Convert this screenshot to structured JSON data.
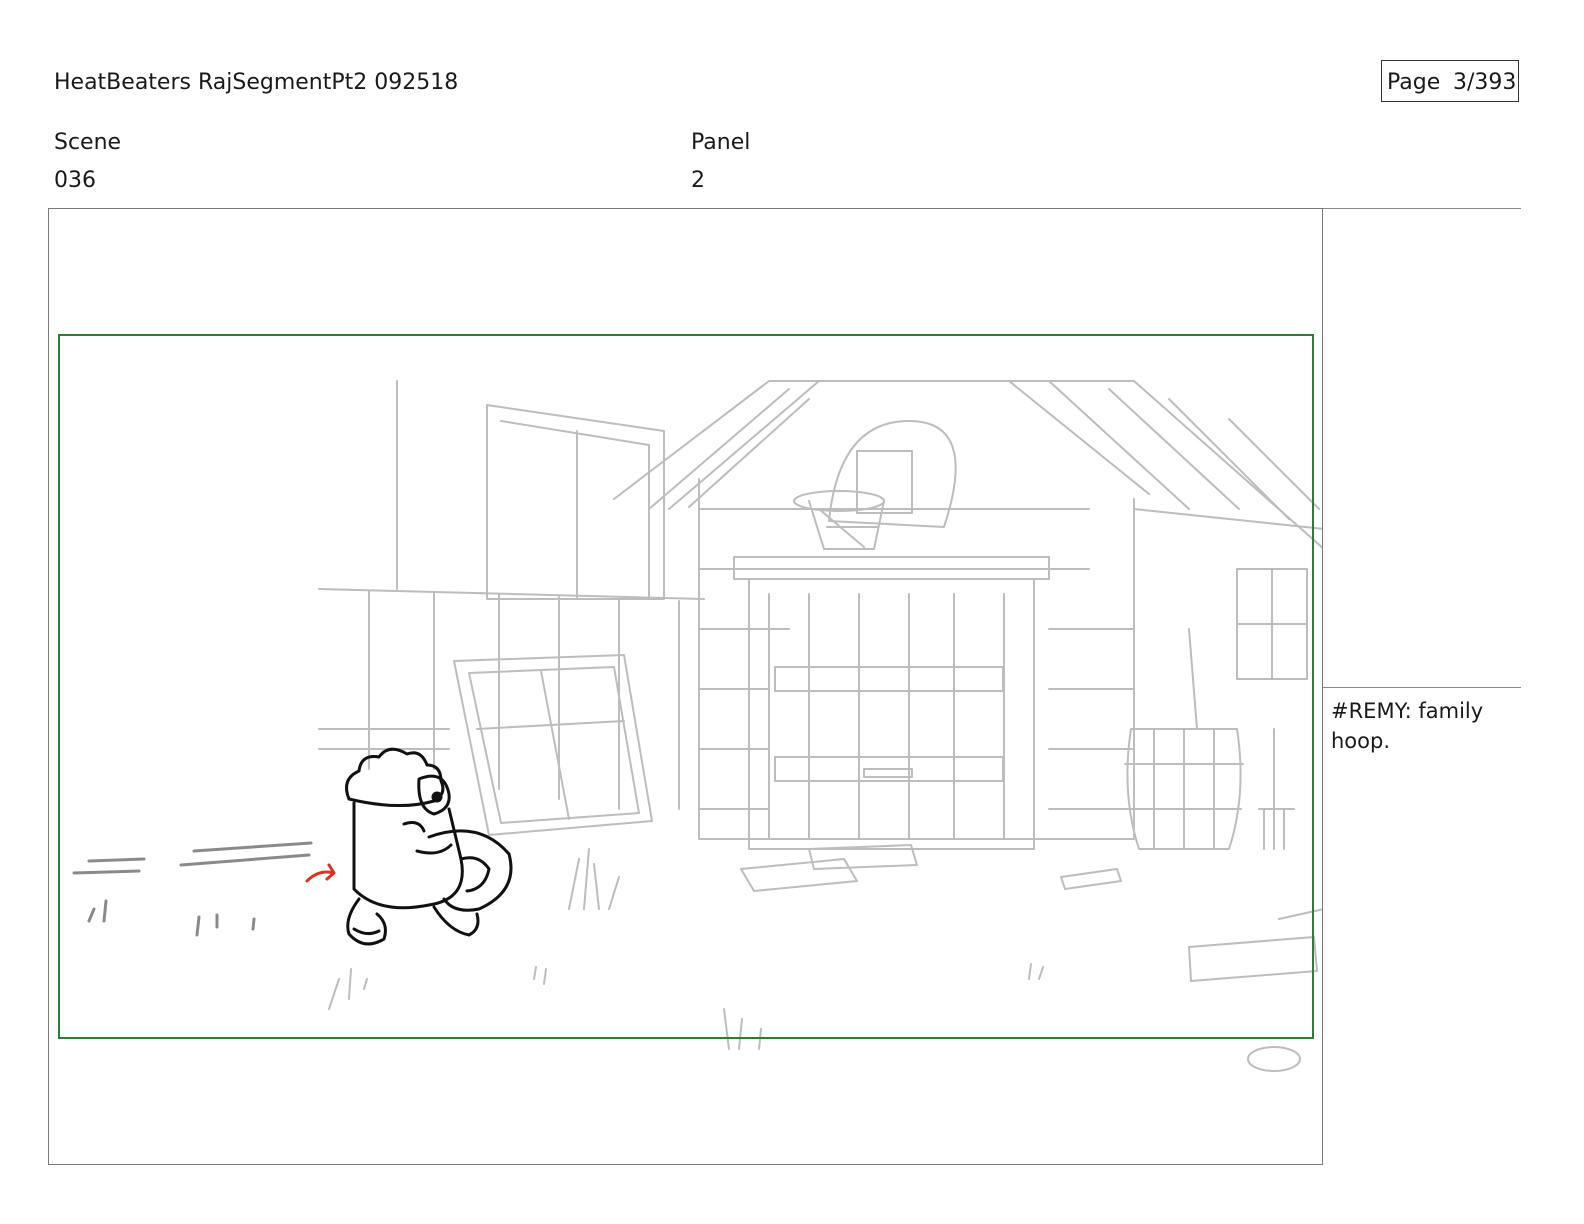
{
  "header": {
    "title": "HeatBeaters RajSegmentPt2 092518",
    "page_label": "Page",
    "page_number": "3/393"
  },
  "fields": {
    "scene_label": "Scene",
    "scene_value": "036",
    "panel_label": "Panel",
    "panel_value": "2"
  },
  "notes": {
    "dialogue": "#REMY: family hoop."
  },
  "colors": {
    "safe_frame": "#2e7d32",
    "background_lines": "#bdbdbd",
    "character_ink": "#111111",
    "action_arrow": "#d9341f"
  }
}
